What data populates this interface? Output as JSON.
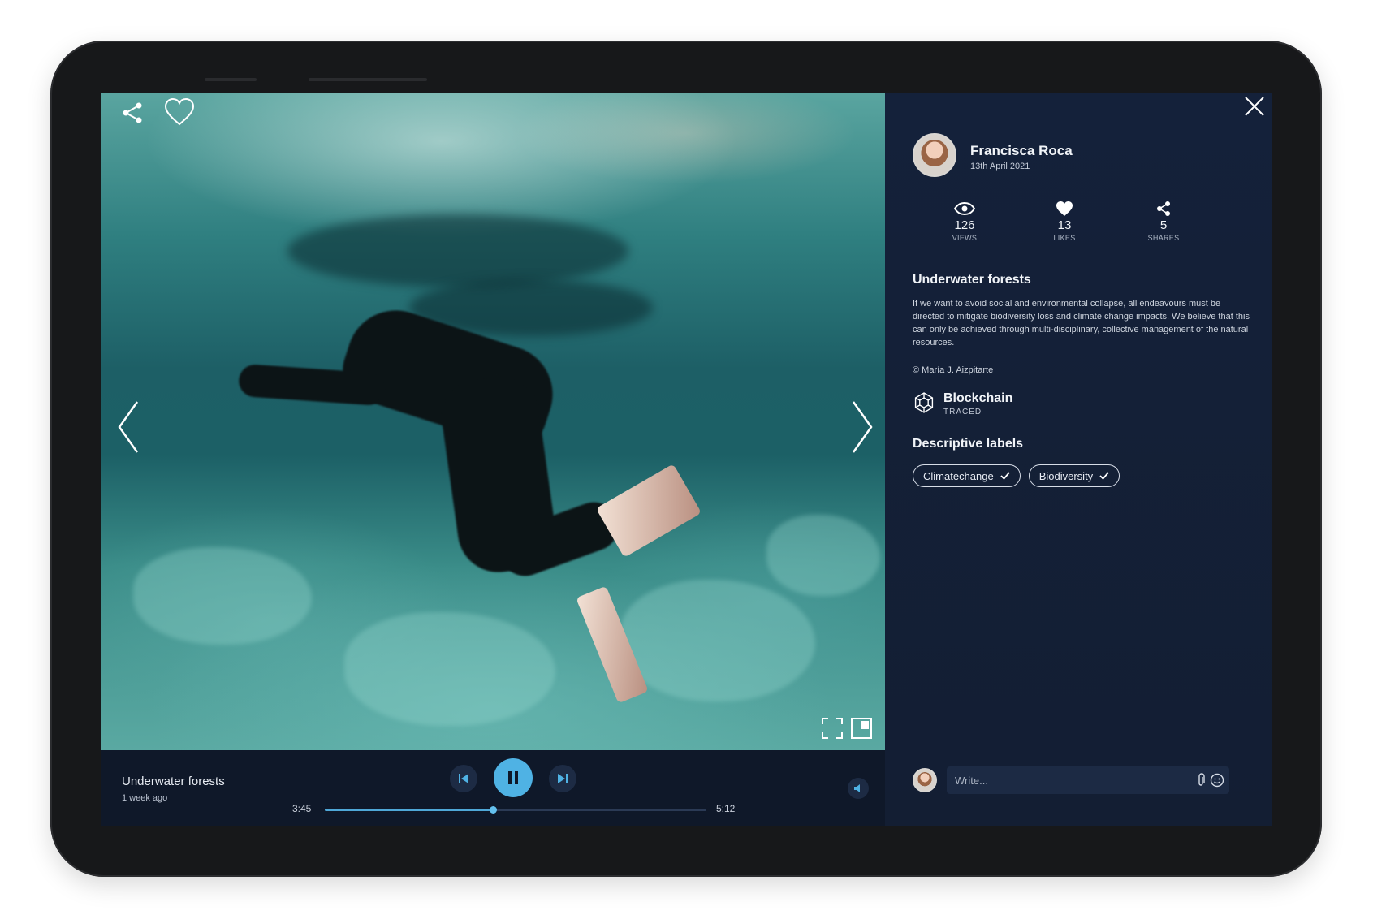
{
  "media": {
    "share_icon": "share-icon",
    "like_icon": "heart-outline-icon",
    "prev_icon": "chevron-left-icon",
    "next_icon": "chevron-right-icon",
    "fullscreen_icon": "fullscreen-icon",
    "pip_icon": "picture-in-picture-icon"
  },
  "player": {
    "title": "Underwater forests",
    "subtitle": "1 week ago",
    "current_time": "3:45",
    "total_time": "5:12",
    "progress": 0.44,
    "accent": "#4fb2e4"
  },
  "panel": {
    "author": {
      "name": "Francisca Roca",
      "date": "13th April 2021"
    },
    "stats": [
      {
        "icon": "eye-icon",
        "value": "126",
        "label": "VIEWS"
      },
      {
        "icon": "heart-icon",
        "value": "13",
        "label": "LIKES"
      },
      {
        "icon": "share-icon",
        "value": "5",
        "label": "SHARES"
      }
    ],
    "post": {
      "title": "Underwater forests",
      "description": "If we want to avoid social and environmental collapse, all endeavours must be directed to mitigate biodiversity loss and climate change impacts. We believe that this can only be achieved through multi-disciplinary, collective management of the natural resources.",
      "credit": "© María J. Aizpitarte"
    },
    "blockchain": {
      "title": "Blockchain",
      "subtitle": "TRACED"
    },
    "labels": {
      "title": "Descriptive labels",
      "items": [
        "Climatechange",
        "Biodiversity"
      ]
    },
    "comment": {
      "placeholder": "Write..."
    }
  }
}
